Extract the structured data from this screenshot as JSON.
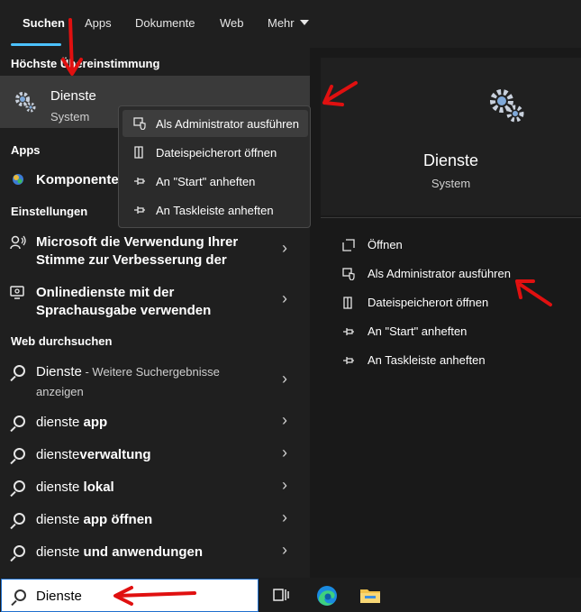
{
  "tabs": [
    {
      "label": "Suchen",
      "active": true
    },
    {
      "label": "Apps"
    },
    {
      "label": "Dokumente"
    },
    {
      "label": "Web"
    },
    {
      "label": "Mehr"
    }
  ],
  "sections": {
    "best_match": "Höchste Übereinstimmung",
    "apps": "Apps",
    "settings": "Einstellungen",
    "web": "Web durchsuchen"
  },
  "best_match": {
    "title": "Dienste",
    "subtitle": "System"
  },
  "apps_item": "Komponentendienste",
  "settings_items": [
    {
      "line1": "Microsoft die Verwendung Ihrer",
      "line2": "Stimme zur Verbesserung der"
    },
    {
      "line1": "Onlinedienste mit der",
      "line2": "Sprachausgabe verwenden"
    }
  ],
  "web_items": {
    "first": {
      "term": "Dienste",
      "suffix": " - Weitere Suchergebnisse",
      "line2": "anzeigen"
    },
    "suggestions": [
      {
        "prefix": "dienste ",
        "bold": "app"
      },
      {
        "prefix": "dienste",
        "bold": "verwaltung"
      },
      {
        "prefix": "dienste ",
        "bold": "lokal"
      },
      {
        "prefix": "dienste ",
        "bold": "app öffnen"
      },
      {
        "prefix": "dienste ",
        "bold": "und anwendungen"
      }
    ]
  },
  "context_menu": [
    "Als Administrator ausführen",
    "Dateispeicherort öffnen",
    "An \"Start\" anheften",
    "An Taskleiste anheften"
  ],
  "preview": {
    "title": "Dienste",
    "subtitle": "System"
  },
  "actions": [
    "Öffnen",
    "Als Administrator ausführen",
    "Dateispeicherort öffnen",
    "An \"Start\" anheften",
    "An Taskleiste anheften"
  ],
  "search": {
    "value": "Dienste"
  },
  "icons": {
    "gear": "gear-icon",
    "search": "search-icon",
    "shield": "shield-icon",
    "folder": "folder-icon",
    "pin": "pin-icon",
    "open": "open-icon",
    "speech": "speech-icon",
    "monitor": "monitor-speech-icon",
    "taskview": "task-view-icon",
    "edge": "edge-icon",
    "explorer": "file-explorer-icon"
  },
  "colors": {
    "accent": "#4cc2ff",
    "annotation": "#e01010"
  }
}
